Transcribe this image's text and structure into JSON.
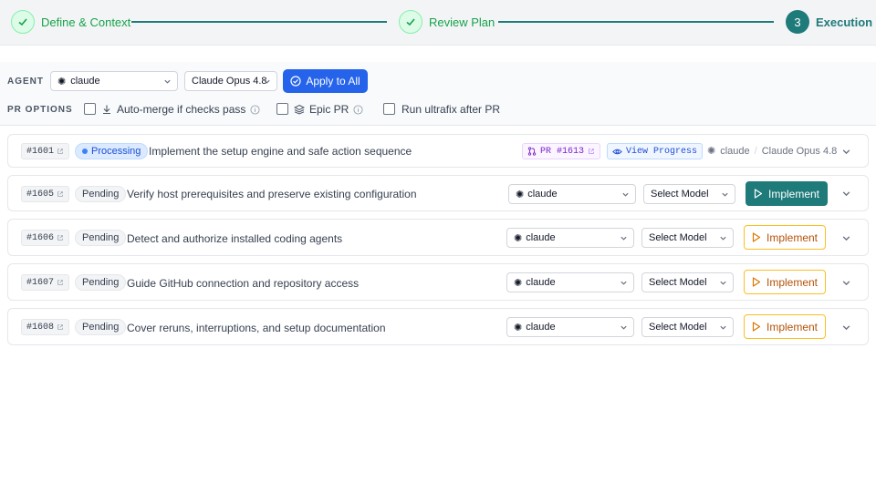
{
  "stepper": {
    "steps": [
      {
        "label": "Define & Context",
        "state": "done"
      },
      {
        "label": "Review Plan",
        "state": "done"
      },
      {
        "label": "Execution",
        "state": "current",
        "number": "3"
      }
    ]
  },
  "options": {
    "agent_label": "AGENT",
    "agent_value": "claude",
    "model_value": "Claude Opus 4.8",
    "apply_label": "Apply to All",
    "pr_label": "PR OPTIONS",
    "automerge_label": "Auto-merge if checks pass",
    "epic_label": "Epic PR",
    "ultrafix_label": "Run ultrafix after PR"
  },
  "rows": [
    {
      "issue": "#1601",
      "status": "Processing",
      "title": "Implement the setup engine and safe action sequence",
      "pr": "PR #1613",
      "view": "View Progress",
      "agent": "claude",
      "sep": "/",
      "model": "Claude Opus 4.8"
    },
    {
      "issue": "#1605",
      "status": "Pending",
      "title": "Verify host prerequisites and preserve existing configuration",
      "agent": "claude",
      "model": "Select Model",
      "action": "Implement"
    },
    {
      "issue": "#1606",
      "status": "Pending",
      "title": "Detect and authorize installed coding agents",
      "agent": "claude",
      "model": "Select Model",
      "action": "Implement"
    },
    {
      "issue": "#1607",
      "status": "Pending",
      "title": "Guide GitHub connection and repository access",
      "agent": "claude",
      "model": "Select Model",
      "action": "Implement"
    },
    {
      "issue": "#1608",
      "status": "Pending",
      "title": "Cover reruns, interruptions, and setup documentation",
      "agent": "claude",
      "model": "Select Model",
      "action": "Implement"
    }
  ],
  "colors": {
    "accent": "#1f7a7a",
    "primary": "#2563eb",
    "success": "#16a34a",
    "warning": "#fbbf24"
  }
}
